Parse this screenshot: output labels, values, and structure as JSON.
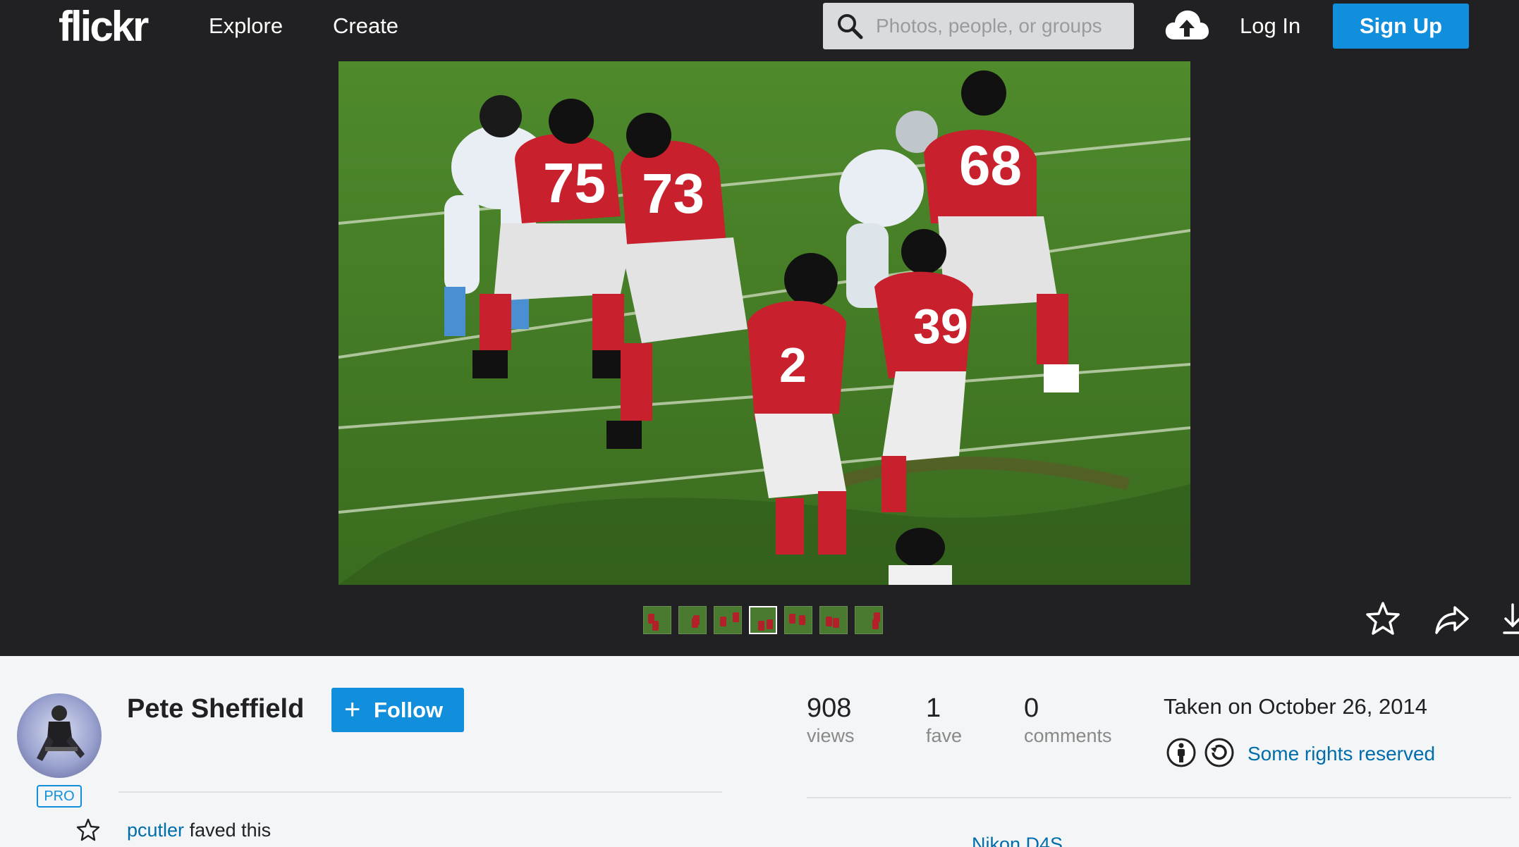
{
  "header": {
    "logo": "flickr",
    "nav": [
      "Explore",
      "Create"
    ],
    "search_placeholder": "Photos, people, or groups",
    "upload_icon": "cloud-upload-icon",
    "login_label": "Log In",
    "signup_label": "Sign Up"
  },
  "photo": {
    "filmstrip_count": 7,
    "active_thumb": 4,
    "actions": [
      "star-icon",
      "share-icon",
      "download-icon"
    ]
  },
  "owner": {
    "name": "Pete Sheffield",
    "badge": "PRO",
    "follow_label": "Follow"
  },
  "activity": {
    "user": "pcutler",
    "action": "faved this"
  },
  "stats": {
    "views_count": "908",
    "views_label": "views",
    "faves_count": "1",
    "faves_label": "fave",
    "comments_count": "0",
    "comments_label": "comments"
  },
  "meta": {
    "taken": "Taken on October 26, 2014",
    "license_icons": [
      "cc-by-icon",
      "cc-sa-icon"
    ],
    "license_label": "Some rights reserved",
    "camera": "Nikon D4S"
  },
  "colors": {
    "nav_bg": "#212124",
    "accent": "#128fdc",
    "link": "#006dac",
    "page_bg": "#f3f5f6"
  }
}
